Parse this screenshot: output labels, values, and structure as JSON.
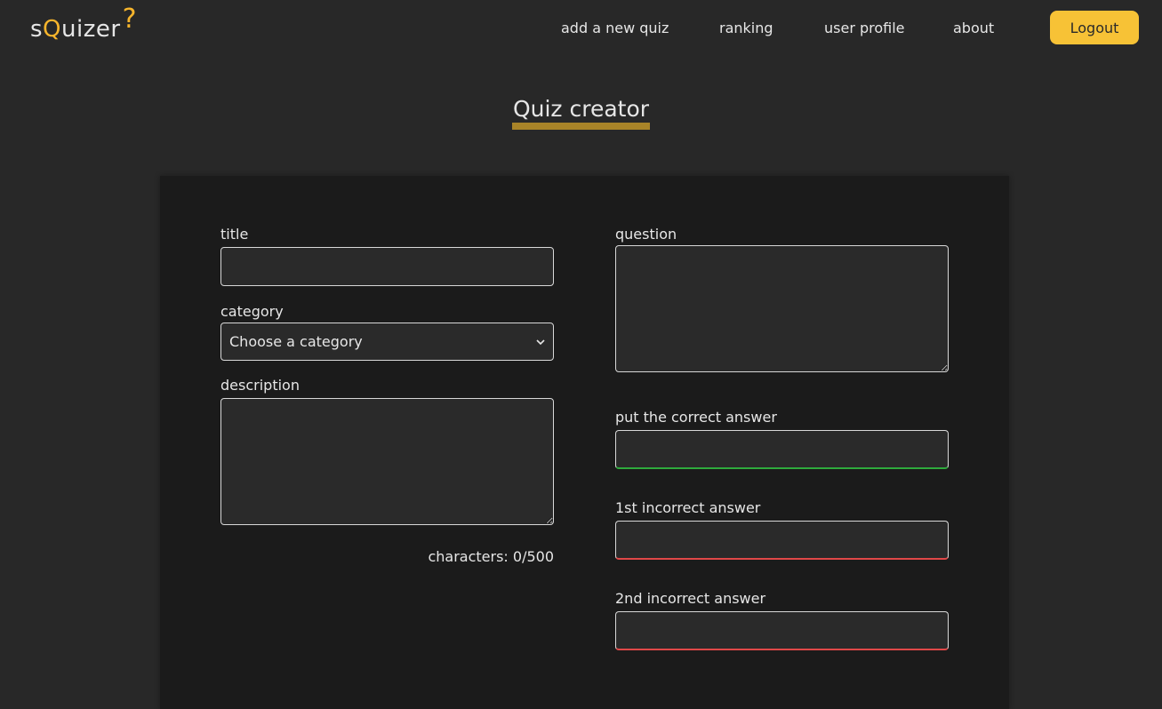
{
  "brand": {
    "prefix": "s",
    "highlight": "Q",
    "suffix": "uizer",
    "mark": "?"
  },
  "nav": {
    "items": [
      "add a new quiz",
      "ranking",
      "user profile",
      "about"
    ],
    "logout_label": "Logout"
  },
  "page": {
    "title": "Quiz creator"
  },
  "form": {
    "title_label": "title",
    "title_value": "",
    "category_label": "category",
    "category_selected": "Choose a category",
    "description_label": "description",
    "description_value": "",
    "counter_text": "characters: 0/500",
    "question_label": "question",
    "question_value": "",
    "correct_label": "put the correct answer",
    "correct_value": "",
    "incorrect1_label": "1st incorrect answer",
    "incorrect1_value": "",
    "incorrect2_label": "2nd incorrect answer",
    "incorrect2_value": ""
  },
  "colors": {
    "accent": "#f7c236",
    "underline": "#a98428",
    "correct": "#2eaa3c",
    "wrong": "#e04848",
    "background": "#282828",
    "card": "#1b1b1b"
  },
  "icons": {
    "select": "chevron-down-icon"
  }
}
